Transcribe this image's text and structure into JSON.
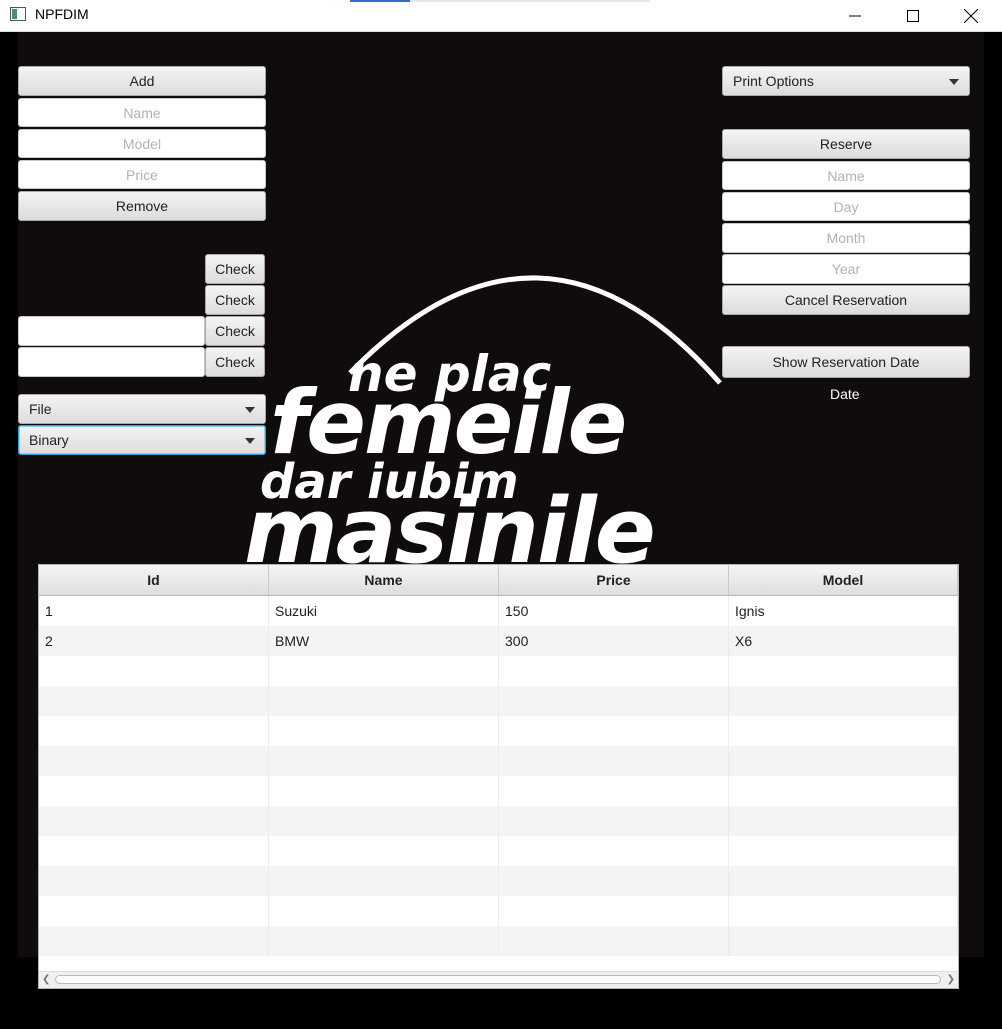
{
  "window": {
    "title": "NPFDIM"
  },
  "left_panel": {
    "add_label": "Add",
    "name_placeholder": "Name",
    "model_placeholder": "Model",
    "price_placeholder": "Price",
    "remove_label": "Remove",
    "check_labels": [
      "Check",
      "Check",
      "Check",
      "Check"
    ],
    "file_combo": "File",
    "format_combo": "Binary"
  },
  "right_panel": {
    "print_options": "Print Options",
    "reserve_label": "Reserve",
    "name_placeholder": "Name",
    "day_placeholder": "Day",
    "month_placeholder": "Month",
    "year_placeholder": "Year",
    "cancel_label": "Cancel Reservation",
    "show_date_label": "Show Reservation Date",
    "date_text": "Date"
  },
  "logo": {
    "line1": "ne plac",
    "line2": "femeile",
    "line3": "dar iubim",
    "line4": "masinile"
  },
  "table": {
    "columns": [
      "Id",
      "Name",
      "Price",
      "Model"
    ],
    "rows": [
      [
        "1",
        "Suzuki",
        "150",
        "Ignis"
      ],
      [
        "2",
        "BMW",
        "300",
        "X6"
      ]
    ]
  },
  "colors": {
    "background": "#0f0c0b",
    "focus": "#2aa0d6"
  }
}
